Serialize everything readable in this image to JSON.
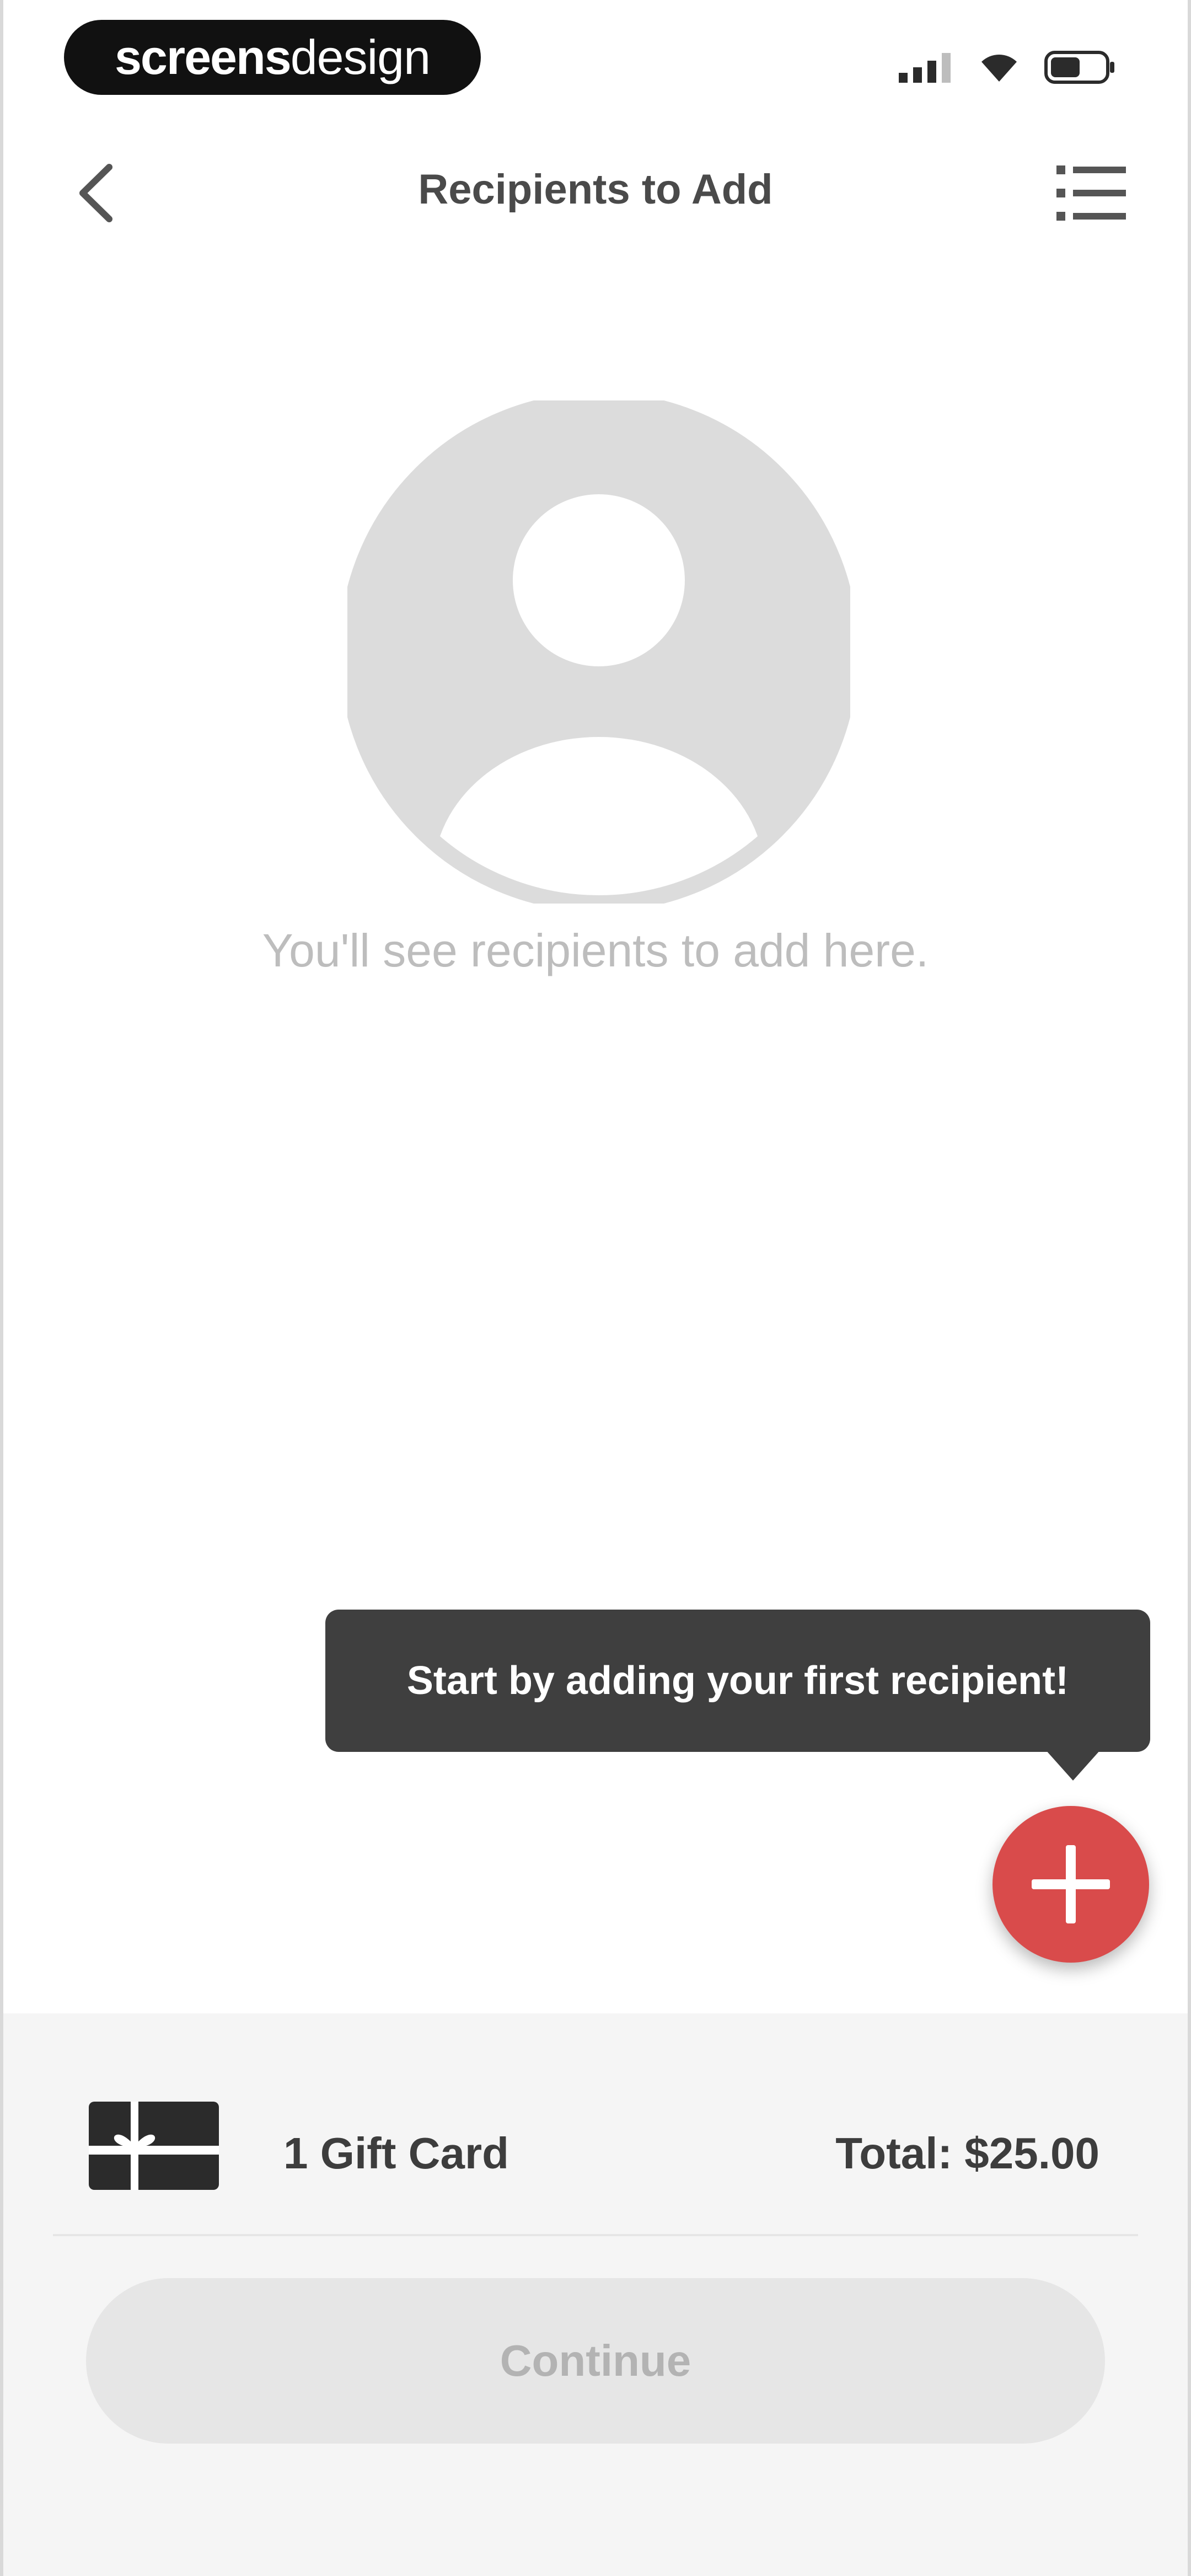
{
  "status_bar": {
    "watermark_bold": "screens",
    "watermark_light": "design",
    "icons": [
      "signal-icon",
      "wifi-icon",
      "battery-icon"
    ]
  },
  "nav": {
    "back_icon": "chevron-left-icon",
    "title": "Recipients to Add",
    "menu_icon": "list-icon"
  },
  "empty_state": {
    "icon": "avatar-placeholder-icon",
    "message": "You'll see recipients to add here."
  },
  "tooltip": {
    "text": "Start by adding your first recipient!"
  },
  "fab": {
    "icon": "plus-icon",
    "color": "#d94b4b"
  },
  "summary": {
    "giftcard_icon": "gift-card-icon",
    "count_label": "1 Gift Card",
    "total_label": "Total: $25.00"
  },
  "actions": {
    "continue_label": "Continue"
  },
  "colors": {
    "accent": "#d94b4b",
    "tooltip_bg": "#3f3f3f",
    "panel_bg": "#f5f5f5",
    "button_disabled_bg": "#e6e6e6",
    "placeholder_gray": "#dcdcdc"
  }
}
